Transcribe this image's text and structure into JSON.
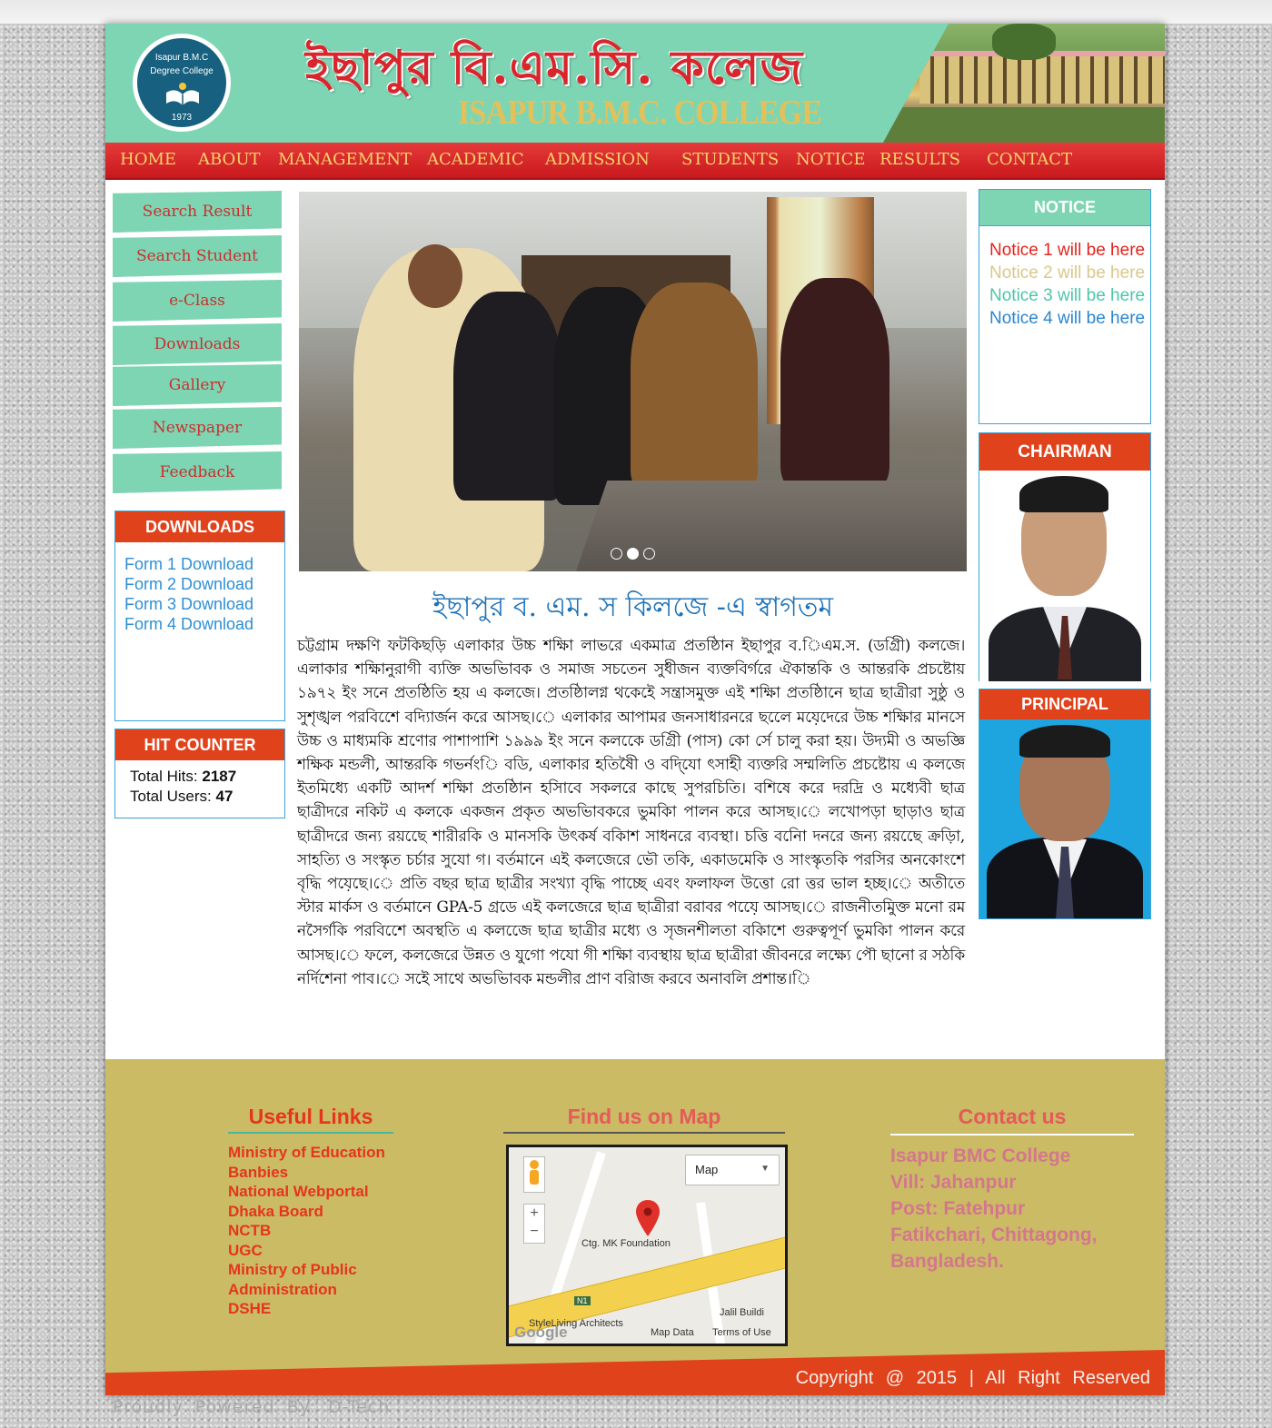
{
  "header": {
    "logo_line1": "Isapur B.M.C",
    "logo_line2": "Degree College",
    "logo_year": "1973",
    "title_bn": "ইছাপুর বি.এম.সি. কলেজ",
    "title_en": "ISAPUR B.M.C. COLLEGE"
  },
  "nav": {
    "items": [
      "HOME",
      "ABOUT",
      "MANAGEMENT",
      "ACADEMIC",
      "ADMISSION",
      "STUDENTS",
      "NOTICE",
      "RESULTS",
      "CONTACT"
    ]
  },
  "sidebar": {
    "menu": [
      "Search Result",
      "Search Student",
      "e-Class",
      "Downloads",
      "Gallery",
      "Newspaper",
      "Feedback"
    ],
    "downloads": {
      "title": "DOWNLOADS",
      "links": [
        "Form 1 Download",
        "Form 2 Download",
        "Form 3 Download",
        "Form 4 Download"
      ]
    },
    "hit_counter": {
      "title": "HIT COUNTER",
      "hits_label": "Total Hits:",
      "hits_value": "2187",
      "users_label": "Total Users:",
      "users_value": "47"
    }
  },
  "slider": {
    "dots": 3,
    "active_dot": 2
  },
  "welcome": {
    "title": "ইছাপুর ব. এম. স কিলজে -এ স্বাগতম",
    "body": "চট্টগ্রাম দক্ষণি ফটকিছড়ি এলাকার উচ্চ শক্ষিা লাভরে একমাত্র প্রতষ্ঠিান ইছাপুর ব.িএম.স. (ডগ্রিী) কলজে। এলাকার শক্ষিানুরাগী ব্যক্তি অভভিাবক ও সমাজ সচতেন সুধীজন ব্যক্তবির্গরে ঐকান্তকি ও আন্তরকি প্রচষ্টোয় ১৯৭২ ইং সনে প্রতষ্ঠিতি হয় এ কলজে। প্রতষ্ঠিালগ্ন থকেইে সন্ত্রাসমুক্ত এই শক্ষিা প্রতষ্ঠিানে ছাত্র ছাত্রীরা সুষ্ঠু ও সুশৃঙ্খল পরবিশেে বদ্যিার্জন করে আসছ।ে এলাকার আপামর জনসাধারনরে ছলেে মযে়দেরে উচ্চ শক্ষিার মানসে উচ্চ ও মাধ্যমকি শ্রণোর পাশাপাশি ১৯৯৯ ইং সনে কলকেে ডগ্রিী (পাস) কো র্সে চালু করা হয়। উদ্যমী ও অভজ্ঞি শক্ষিক মন্ডলী, আন্তরকি গভর্নংি বডি, এলাকার হতিষৈী ও বদি্যো ৎসাহী ব্যক্তরি সম্মলিতি প্রচষ্টোয় এ কলজে ইতমিধ্যে একটি আদর্শ শক্ষিা প্রতষ্ঠিান হসিাবে সকলরে কাছে সুপরচিতি। বশিষে করে দরদ্রি ও মধ্যেবী ছাত্র ছাত্রীদরে নকিট এ কলকে একজন প্রকৃত অভভিাবকরে ভুমকিা পালন করে আসছ।ে লখোপড়া ছাড়াও ছাত্র ছাত্রীদরে জন্য রয়ছেে শারীরকি ও মানসকি উৎকর্ষ বকিাশ সাধনরে ব্যবস্থা। চত্তি বনিো দনরে জন্য রয়ছেে ক্রড়িা, সাহত্যি ও সংস্কৃত চর্চার সুযো গ। বর্তমানে এই কলজেরে ভৌ তকি, একাডমেকি ও সাংস্কৃতকি পরসির অনকোংশে বৃদ্ধি পযে়ছে।ে প্রতি বছর ছাত্র ছাত্রীর সংখ্যা বৃদ্ধি পাচ্ছে এবং ফলাফল উত্তো রো ত্তর ভাল হচ্ছ।ে অতীতে স্টার মার্কস ও বর্তমানে GPA-5 গ্রডে এই কলজেরে ছাত্র ছাত্রীরা বরাবর পযে়ে আসছ।ে রাজনীতমিুক্ত মনো রম নসৈর্গকি পরবিশেে অবস্থতি এ কলজেে ছাত্র ছাত্রীর মধ্যে ও সৃজনশীলতা বকিাশে গুরুত্বপূর্ণ ভুমকিা পালন করে আসছ।ে ফলে, কলজেরে উন্নত ও যুগো পযো গী শক্ষিা ব্যবস্থায় ছাত্র ছাত্রীরা জীবনরে লক্ষ্যে পৌ ছানো র সঠকি নর্দিশেনা পাব।ে সইে সাথে অভভিাবক মন্ডলীর প্রাণ বরিাজ করবে অনাবলি প্রশান্ত।ি"
  },
  "notice": {
    "title": "NOTICE",
    "items": [
      {
        "text": "Notice 1 will be here",
        "color": "#e5241c"
      },
      {
        "text": "Notice 2 will be here",
        "color": "#d9c98a"
      },
      {
        "text": "Notice 3 will be here",
        "color": "#4ec6a8"
      },
      {
        "text": "Notice 4 will be here",
        "color": "#2a86cf"
      }
    ]
  },
  "chairman": {
    "title": "CHAIRMAN"
  },
  "principal": {
    "title": "PRINCIPAL"
  },
  "footer": {
    "useful_links": {
      "title": "Useful Links",
      "links": [
        "Ministry of Education",
        "Banbies",
        "National Webportal",
        "Dhaka Board",
        "NCTB",
        "UGC",
        "Ministry of Public Administration",
        "DSHE"
      ]
    },
    "map": {
      "title": "Find us on Map",
      "type_label": "Map",
      "place_label": "Ctg. MK Foundation",
      "road_label": "N1",
      "place2_label": "Jalil Buildi",
      "place3_label": "StyleLiving Architects",
      "data_label": "Map Data",
      "terms_label": "Terms of Use",
      "brand_label": "Google"
    },
    "contact": {
      "title": "Contact us",
      "lines": [
        "Isapur BMC College",
        "Vill: Jahanpur",
        "Post: Fatehpur",
        "Fatikchari, Chittagong,",
        "Bangladesh."
      ]
    },
    "copyright": "Copyright @ 2015 | All Right Reserved"
  },
  "powered_by": "Proudly Powered By: D-Tech",
  "colors": {
    "mint": "#7dd5b4",
    "red": "#e0421b",
    "nav_gold": "#f3d36b",
    "footer_bg": "#cabb64",
    "link_blue": "#2e8fd3"
  }
}
